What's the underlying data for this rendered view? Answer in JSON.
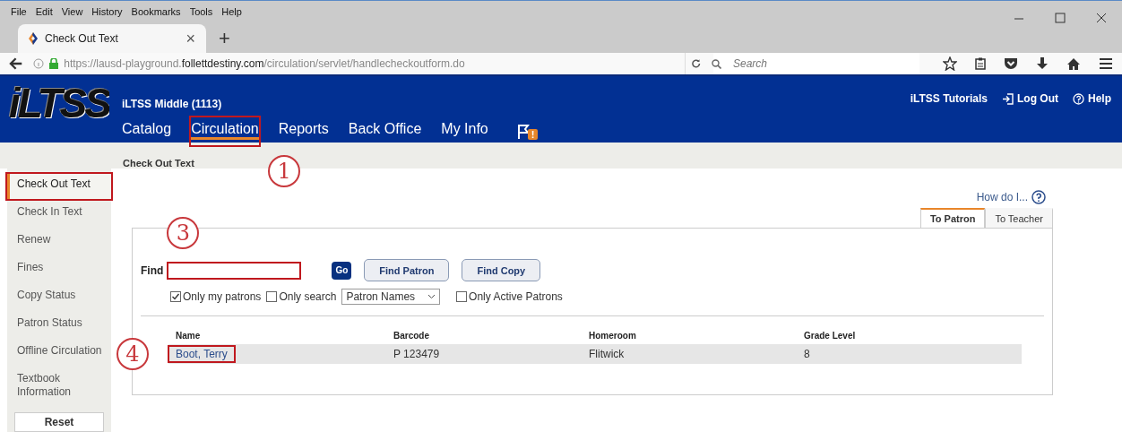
{
  "menu_bar": [
    "File",
    "Edit",
    "View",
    "History",
    "Bookmarks",
    "Tools",
    "Help"
  ],
  "browser_tab": {
    "title": "Check Out Text",
    "close": "×",
    "new_tab": "+"
  },
  "address_bar": {
    "url": "https://lausd-playground.**follettdestiny.com**/circulation/servlet/handlecheckoutform.do",
    "search_placeholder": "Search"
  },
  "header": {
    "logo": "iLTSS",
    "site": "iLTSS Middle (1113)",
    "nav": [
      {
        "label": "Catalog",
        "selected": false,
        "annotated": false
      },
      {
        "label": "Circulation",
        "selected": true,
        "annotated": true,
        "callout": "1"
      },
      {
        "label": "Reports",
        "selected": false,
        "annotated": false
      },
      {
        "label": "Back Office",
        "selected": false,
        "annotated": false
      },
      {
        "label": "My Info",
        "selected": false,
        "annotated": false
      }
    ],
    "alert_badge": "!",
    "tutorials": "iLTSS Tutorials",
    "logout": "Log Out",
    "help": "Help"
  },
  "breadcrumb": "Check Out Text",
  "sidebar": {
    "items": [
      {
        "label": "Check Out Text",
        "selected": true,
        "annotated": true
      },
      {
        "label": "Check In Text",
        "selected": false,
        "annotated": false
      },
      {
        "label": "Renew",
        "selected": false,
        "annotated": false
      },
      {
        "label": "Fines",
        "selected": false,
        "annotated": false
      },
      {
        "label": "Copy Status",
        "selected": false,
        "annotated": false
      },
      {
        "label": "Patron Status",
        "selected": false,
        "annotated": false
      },
      {
        "label": "Offline Circulation",
        "selected": false,
        "annotated": false
      },
      {
        "label": "Textbook Information",
        "selected": false,
        "annotated": false
      }
    ],
    "reset": "Reset"
  },
  "how_do_i": "How do I...",
  "tabs": [
    {
      "label": "To Patron",
      "selected": true
    },
    {
      "label": "To Teacher",
      "selected": false
    }
  ],
  "find": {
    "label": "Find",
    "annotated": true,
    "callout": "3",
    "go": "Go",
    "buttons": [
      "Find Patron",
      "Find Copy"
    ]
  },
  "options": [
    {
      "kind": "checkbox",
      "label": "Only my patrons",
      "checked": true
    },
    {
      "kind": "checkbox",
      "label": "Only search",
      "checked": false
    },
    {
      "kind": "select",
      "value": "Patron Names"
    },
    {
      "kind": "checkbox",
      "label": "Only Active Patrons",
      "checked": false
    }
  ],
  "table": {
    "columns": [
      "Name",
      "Barcode",
      "Homeroom",
      "Grade Level"
    ],
    "rows": [
      {
        "cells": [
          "Boot, Terry",
          "P 123479",
          "Flitwick",
          "8"
        ],
        "annotated": true,
        "callout": "4"
      }
    ]
  }
}
